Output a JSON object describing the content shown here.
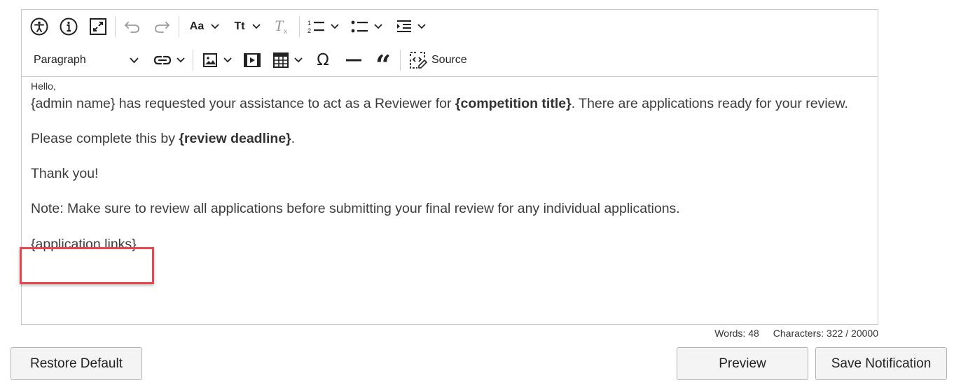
{
  "toolbar": {
    "row1": [
      {
        "name": "accessibility-icon"
      },
      {
        "name": "info-icon"
      },
      {
        "name": "fullscreen-icon"
      },
      {
        "name": "undo-icon"
      },
      {
        "name": "redo-icon"
      },
      {
        "name": "font-family-icon",
        "text": "Aa"
      },
      {
        "name": "font-size-icon",
        "text": "Tt"
      },
      {
        "name": "remove-format-icon"
      },
      {
        "name": "numbered-list-icon"
      },
      {
        "name": "bulleted-list-icon"
      },
      {
        "name": "indent-icon"
      }
    ],
    "paragraph_label": "Paragraph",
    "source_label": "Source"
  },
  "content": {
    "greeting": "Hello,",
    "line1_pre": "{admin name} has requested your assistance to act as a Reviewer for ",
    "line1_bold": "{competition title}",
    "line1_post": ". There are applications ready for your review.",
    "line2_pre": "Please complete this by ",
    "line2_bold": "{review deadline}",
    "line2_post": ".",
    "line3": "Thank you!",
    "line4": "Note: Make sure to review all applications before submitting your final review for any individual applications.",
    "line5": "{application links}"
  },
  "stats": {
    "words": "Words: 48",
    "characters": "Characters: 322 / 20000"
  },
  "buttons": {
    "restore": "Restore Default",
    "preview": "Preview",
    "save": "Save Notification"
  },
  "colors": {
    "highlight": "#e8454e",
    "border": "#c8c8c8",
    "button_bg": "#f4f4f4"
  }
}
